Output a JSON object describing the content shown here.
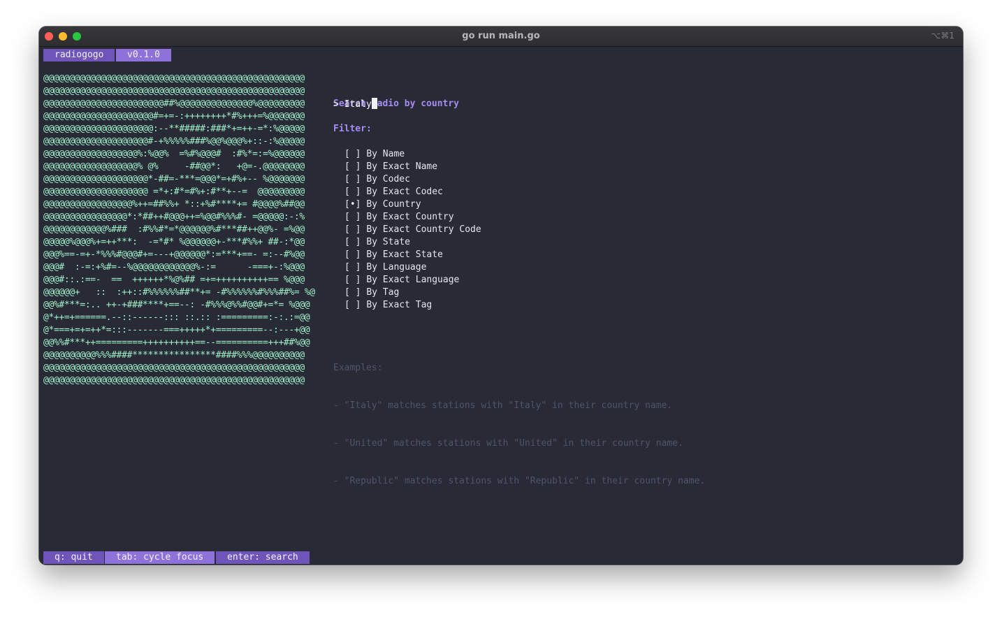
{
  "window": {
    "title": "go run main.go",
    "shortcut": "⌥⌘1"
  },
  "header": {
    "app_name": "radiogogo",
    "version": "v0.1.0"
  },
  "colors": {
    "accent_dark": "#6f55b9",
    "accent_light": "#8f72d9",
    "background": "#282a36",
    "heading": "#a58cf2",
    "ascii": "#9ff0c8"
  },
  "ascii_art": [
    "@@@@@@@@@@@@@@@@@@@@@@@@@@@@@@@@@@@@@@@@@@@@@@@@@@",
    "@@@@@@@@@@@@@@@@@@@@@@@@@@@@@@@@@@@@@@@@@@@@@@@@@@",
    "@@@@@@@@@@@@@@@@@@@@@@@##%@@@@@@@@@@@@@@%@@@@@@@@@",
    "@@@@@@@@@@@@@@@@@@@@@#=+=-:++++++++*#%+++=%@@@@@@@",
    "@@@@@@@@@@@@@@@@@@@@@:--**#####:###*+=++-=*:%@@@@@",
    "@@@@@@@@@@@@@@@@@@@@#-+%%%%%###%@@%@@@%+::-:%@@@@@",
    "@@@@@@@@@@@@@@@@@@%:%@@%  =%#%@@@#  :#%*=:=%@@@@@@",
    "@@@@@@@@@@@@@@@@@@% @%     -##@@*:   +@=-.@@@@@@@@",
    "@@@@@@@@@@@@@@@@@@@@*-##=-***=@@@*=+#%+-- %@@@@@@@",
    "@@@@@@@@@@@@@@@@@@@@ =*+:#*=#%+:#**+--=  @@@@@@@@@",
    "@@@@@@@@@@@@@@@@@%++=##%%+ *::+%#****+= #@@@@%##@@",
    "@@@@@@@@@@@@@@@@*:*##++#@@@++=%@@#%%%#- =@@@@@:-:%",
    "@@@@@@@@@@@@%###  :#%%#*=*@@@@@@%#***##++@@%- =%@@",
    "@@@@@%@@@%+=++***:  -=*#* %@@@@@@+-***#%%+ ##-:*@@",
    "@@@%==-=+-*%%%#@@@#+=---+@@@@@@*:=***+==- =:--#%@@",
    "@@@#  :-=:+%#=--%@@@@@@@@@@@@%-:=      -===+-:%@@@",
    "@@@#::.:==-  ==  ++++++*%@%## =+=++++++++++== %@@@",
    "@@@@@@+   ::  :++::#%%%%%%##**+= -#%%%%%%#%%%##%= %@",
    "@@%#***=:.. ++-+###****+==--: -#%%%@%%#@@#+=*= %@@@",
    "@*++=+======.--::------::: ::.:: :=========:-:.:=@@",
    "@*===+=+=++*=:::-------===+++++*+=========--:---+@@",
    "@@%%#***++=========++++++++++==--==========+++##%@@",
    "@@@@@@@@@@%%%####****************####%%%@@@@@@@@@@",
    "@@@@@@@@@@@@@@@@@@@@@@@@@@@@@@@@@@@@@@@@@@@@@@@@@@",
    "@@@@@@@@@@@@@@@@@@@@@@@@@@@@@@@@@@@@@@@@@@@@@@@@@@"
  ],
  "search": {
    "heading": "Search radio by country",
    "prompt": "> ",
    "value": "Italy",
    "filter_label": "Filter:"
  },
  "filters": [
    {
      "mark": "[ ]",
      "label": "By Name"
    },
    {
      "mark": "[ ]",
      "label": "By Exact Name"
    },
    {
      "mark": "[ ]",
      "label": "By Codec"
    },
    {
      "mark": "[ ]",
      "label": "By Exact Codec"
    },
    {
      "mark": "[•]",
      "label": "By Country"
    },
    {
      "mark": "[ ]",
      "label": "By Exact Country"
    },
    {
      "mark": "[ ]",
      "label": "By Exact Country Code"
    },
    {
      "mark": "[ ]",
      "label": "By State"
    },
    {
      "mark": "[ ]",
      "label": "By Exact State"
    },
    {
      "mark": "[ ]",
      "label": "By Language"
    },
    {
      "mark": "[ ]",
      "label": "By Exact Language"
    },
    {
      "mark": "[ ]",
      "label": "By Tag"
    },
    {
      "mark": "[ ]",
      "label": "By Exact Tag"
    }
  ],
  "examples": {
    "title": "Examples:",
    "lines": [
      "- \"Italy\" matches stations with \"Italy\" in their country name.",
      "- \"United\" matches stations with \"United\" in their country name.",
      "- \"Republic\" matches stations with \"Republic\" in their country name."
    ]
  },
  "footer": {
    "quit": "q: quit",
    "cycle": "tab: cycle focus",
    "search": "enter: search"
  }
}
